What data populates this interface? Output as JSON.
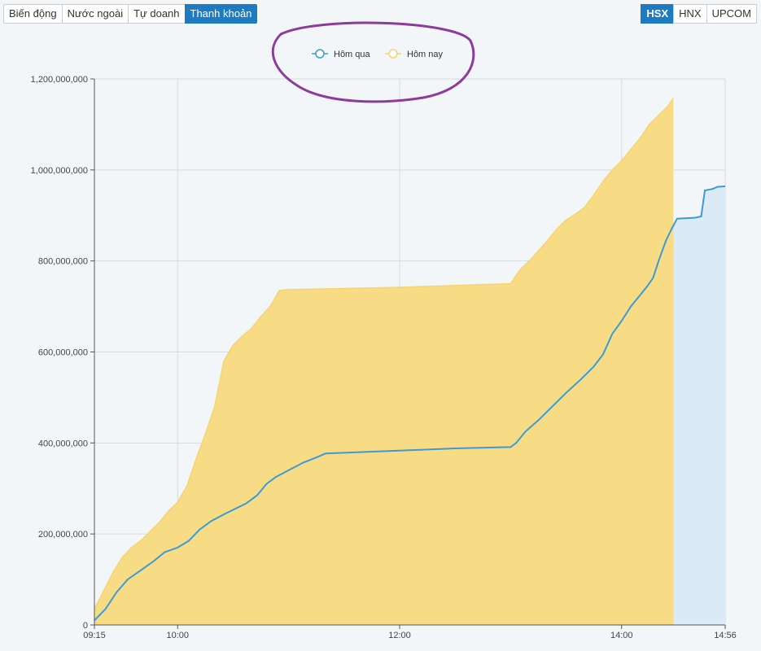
{
  "tabs": [
    {
      "label": "Biến động",
      "active": false
    },
    {
      "label": "Nước ngoài",
      "active": false
    },
    {
      "label": "Tự doanh",
      "active": false
    },
    {
      "label": "Thanh khoản",
      "active": true
    }
  ],
  "exchanges": [
    {
      "label": "HSX",
      "active": true
    },
    {
      "label": "HNX",
      "active": false
    },
    {
      "label": "UPCOM",
      "active": false
    }
  ],
  "colors": {
    "yesterday_line": "#3a9bd5",
    "yesterday_fill": "#dceaf5",
    "today_line": "#f7d36e",
    "today_fill": "#f8dc85",
    "accent": "#1e7bc1",
    "annotation": "#8e3a9a"
  },
  "chart_data": {
    "type": "area",
    "xlabel": "",
    "ylabel": "",
    "ylim": [
      0,
      1200000000
    ],
    "yticks": [
      0,
      200000000,
      400000000,
      600000000,
      800000000,
      1000000000,
      1200000000
    ],
    "ytick_labels": [
      "0",
      "200,000,000",
      "400,000,000",
      "600,000,000",
      "800,000,000",
      "1,000,000,000",
      "1,200,000,000"
    ],
    "xlim": [
      "09:15",
      "14:56"
    ],
    "xticks": [
      "09:15",
      "10:00",
      "12:00",
      "14:00",
      "14:56"
    ],
    "grid": true,
    "legend_position": "top-center",
    "series": [
      {
        "name": "Hôm qua",
        "points": [
          [
            "09:15",
            10000000
          ],
          [
            "09:21",
            35000000
          ],
          [
            "09:27",
            72000000
          ],
          [
            "09:33",
            100000000
          ],
          [
            "09:40",
            120000000
          ],
          [
            "09:47",
            140000000
          ],
          [
            "09:53",
            160000000
          ],
          [
            "10:00",
            170000000
          ],
          [
            "10:06",
            185000000
          ],
          [
            "10:12",
            210000000
          ],
          [
            "10:18",
            228000000
          ],
          [
            "10:25",
            243000000
          ],
          [
            "10:31",
            255000000
          ],
          [
            "10:37",
            267000000
          ],
          [
            "10:43",
            285000000
          ],
          [
            "10:48",
            310000000
          ],
          [
            "10:53",
            325000000
          ],
          [
            "11:00",
            340000000
          ],
          [
            "11:08",
            357000000
          ],
          [
            "11:15",
            368000000
          ],
          [
            "11:20",
            377000000
          ],
          [
            "12:00",
            383000000
          ],
          [
            "12:30",
            388000000
          ],
          [
            "13:00",
            391000000
          ],
          [
            "13:03",
            400000000
          ],
          [
            "13:08",
            425000000
          ],
          [
            "13:15",
            450000000
          ],
          [
            "13:22",
            478000000
          ],
          [
            "13:30",
            510000000
          ],
          [
            "13:38",
            540000000
          ],
          [
            "13:45",
            568000000
          ],
          [
            "13:50",
            595000000
          ],
          [
            "13:55",
            640000000
          ],
          [
            "14:00",
            668000000
          ],
          [
            "14:05",
            700000000
          ],
          [
            "14:10",
            725000000
          ],
          [
            "14:14",
            745000000
          ],
          [
            "14:17",
            763000000
          ],
          [
            "14:20",
            800000000
          ],
          [
            "14:24",
            845000000
          ],
          [
            "14:27",
            870000000
          ],
          [
            "14:30",
            893000000
          ],
          [
            "14:40",
            895000000
          ],
          [
            "14:43",
            898000000
          ],
          [
            "14:45",
            955000000
          ],
          [
            "14:49",
            958000000
          ],
          [
            "14:52",
            963000000
          ],
          [
            "14:56",
            964000000
          ]
        ]
      },
      {
        "name": "Hôm nay",
        "points": [
          [
            "09:15",
            35000000
          ],
          [
            "09:20",
            75000000
          ],
          [
            "09:25",
            115000000
          ],
          [
            "09:30",
            148000000
          ],
          [
            "09:35",
            170000000
          ],
          [
            "09:40",
            185000000
          ],
          [
            "09:45",
            205000000
          ],
          [
            "09:50",
            225000000
          ],
          [
            "09:55",
            250000000
          ],
          [
            "10:00",
            270000000
          ],
          [
            "10:05",
            305000000
          ],
          [
            "10:10",
            365000000
          ],
          [
            "10:15",
            420000000
          ],
          [
            "10:20",
            480000000
          ],
          [
            "10:25",
            580000000
          ],
          [
            "10:30",
            615000000
          ],
          [
            "10:35",
            635000000
          ],
          [
            "10:40",
            652000000
          ],
          [
            "10:45",
            678000000
          ],
          [
            "10:50",
            700000000
          ],
          [
            "10:55",
            735000000
          ],
          [
            "11:00",
            737000000
          ],
          [
            "12:00",
            742000000
          ],
          [
            "13:00",
            750000000
          ],
          [
            "13:05",
            780000000
          ],
          [
            "13:10",
            800000000
          ],
          [
            "13:15",
            822000000
          ],
          [
            "13:20",
            845000000
          ],
          [
            "13:25",
            870000000
          ],
          [
            "13:30",
            890000000
          ],
          [
            "13:35",
            903000000
          ],
          [
            "13:40",
            918000000
          ],
          [
            "13:45",
            945000000
          ],
          [
            "13:50",
            975000000
          ],
          [
            "13:55",
            1000000000
          ],
          [
            "14:00",
            1020000000
          ],
          [
            "14:05",
            1045000000
          ],
          [
            "14:10",
            1070000000
          ],
          [
            "14:15",
            1100000000
          ],
          [
            "14:20",
            1120000000
          ],
          [
            "14:25",
            1140000000
          ],
          [
            "14:28",
            1158000000
          ]
        ]
      }
    ]
  }
}
